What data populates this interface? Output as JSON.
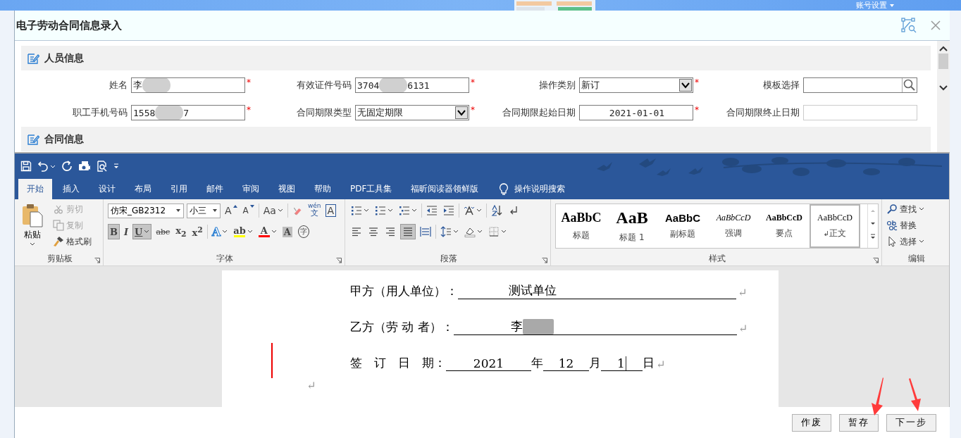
{
  "header": {
    "account_menu": "账号设置"
  },
  "dialog": {
    "title": "电子劳动合同信息录入"
  },
  "sections": [
    {
      "title": "人员信息",
      "fields": [
        {
          "label": "姓名",
          "kind": "text",
          "value_parts": [
            {
              "kind": "text",
              "text": "李"
            },
            {
              "kind": "blur"
            }
          ],
          "required_mark": "*",
          "disabled": false
        },
        {
          "label": "有效证件号码",
          "kind": "text",
          "value_parts": [
            {
              "kind": "text",
              "text": "3704"
            },
            {
              "kind": "blur"
            },
            {
              "kind": "text",
              "text": "6131"
            }
          ],
          "required_mark": "*",
          "disabled": false
        },
        {
          "label": "操作类别",
          "kind": "select",
          "value": "新订",
          "required_mark": "*",
          "disabled": false
        },
        {
          "label": "模板选择",
          "kind": "search",
          "disabled": false
        },
        {
          "label": "职工手机号码",
          "kind": "text",
          "value_parts": [
            {
              "kind": "text",
              "text": "1558"
            },
            {
              "kind": "blur"
            },
            {
              "kind": "text",
              "text": "7"
            }
          ],
          "required_mark": "*",
          "disabled": false
        },
        {
          "label": "合同期限类型",
          "kind": "select",
          "value": "无固定期限",
          "required_mark": "*",
          "disabled": false
        },
        {
          "label": "合同期限起始日期",
          "kind": "date",
          "value": "2021-01-01",
          "required_mark": "*",
          "disabled": false
        },
        {
          "label": "合同期限终止日期",
          "kind": "date",
          "disabled": true
        }
      ]
    },
    {
      "title": "合同信息"
    }
  ],
  "editor": {
    "tabs": [
      {
        "label": "开始",
        "selected": true
      },
      {
        "label": "插入",
        "selected": false
      },
      {
        "label": "设计",
        "selected": false
      },
      {
        "label": "布局",
        "selected": false
      },
      {
        "label": "引用",
        "selected": false
      },
      {
        "label": "邮件",
        "selected": false
      },
      {
        "label": "审阅",
        "selected": false
      },
      {
        "label": "视图",
        "selected": false
      },
      {
        "label": "帮助",
        "selected": false
      },
      {
        "label": "PDF工具集",
        "selected": false
      },
      {
        "label": "福昕阅读器领鲜版",
        "selected": false
      }
    ],
    "tell_me": "操作说明搜索",
    "clipboard": {
      "group": "剪贴板",
      "paste": "粘贴",
      "items": [
        {
          "label": "剪切",
          "kind": "cut",
          "disabled": true
        },
        {
          "label": "复制",
          "kind": "copy",
          "disabled": true
        },
        {
          "label": "格式刷",
          "kind": "painter",
          "disabled": false
        }
      ]
    },
    "font": {
      "group": "字体",
      "name": "仿宋_GB2312",
      "size": "小三",
      "row1": [
        {
          "kind": "grow",
          "glyph": "A"
        },
        {
          "kind": "shrink",
          "glyph": "A"
        },
        {
          "kind": "case",
          "glyph": "Aa"
        },
        {
          "kind": "clear"
        },
        {
          "kind": "phonetic",
          "glyph": "wén",
          "glyph2": "文"
        },
        {
          "kind": "border",
          "glyph": "A"
        }
      ],
      "row2": [
        {
          "kind": "bold",
          "glyph": "B",
          "selected": true
        },
        {
          "kind": "italic",
          "glyph": "I",
          "selected": false
        },
        {
          "kind": "underline",
          "glyph": "U",
          "selected": true
        },
        {
          "kind": "strike",
          "glyph": "abc",
          "selected": false
        },
        {
          "kind": "sub",
          "glyph": "x$_{2}$",
          "selected": false
        },
        {
          "kind": "sup",
          "glyph": "x$^{2}$",
          "selected": false
        },
        {
          "kind": "effects",
          "glyph": "A",
          "selected": false
        },
        {
          "kind": "highlight",
          "glyph": "ab",
          "color": "#ffff00",
          "selected": false
        },
        {
          "kind": "color",
          "glyph": "A",
          "color": "#ff0000",
          "selected": false
        },
        {
          "kind": "shading",
          "glyph": "A",
          "selected": false
        },
        {
          "kind": "enclose",
          "glyph": "字",
          "selected": false
        }
      ]
    },
    "paragraph": {
      "group": "段落",
      "row1": [
        {
          "kind": "bullets",
          "selected": false
        },
        {
          "kind": "numbering",
          "selected": false
        },
        {
          "kind": "multilevel",
          "selected": false
        },
        {
          "kind": "outdent",
          "selected": false
        },
        {
          "kind": "indent",
          "selected": false
        },
        {
          "kind": "asian",
          "selected": false
        },
        {
          "kind": "sort",
          "selected": false
        },
        {
          "kind": "marks",
          "selected": false
        }
      ],
      "row2": [
        {
          "kind": "left",
          "selected": false
        },
        {
          "kind": "center",
          "selected": false
        },
        {
          "kind": "right",
          "selected": false
        },
        {
          "kind": "justify",
          "selected": true
        },
        {
          "kind": "distributed",
          "selected": false
        },
        {
          "kind": "spacing",
          "selected": false
        },
        {
          "kind": "shade",
          "selected": false
        },
        {
          "kind": "borders",
          "selected": false
        }
      ]
    },
    "styles": {
      "group": "样式",
      "items": [
        {
          "kind": "heading",
          "preview": "AaBbC",
          "name": "标题",
          "selected": false
        },
        {
          "kind": "heading1",
          "preview": "AaB",
          "name": "标题 1",
          "selected": false
        },
        {
          "kind": "subtitle",
          "preview": "AaBbC",
          "name": "副标题",
          "selected": false
        },
        {
          "kind": "emphasis",
          "preview": "AaBbCcD",
          "name": "强调",
          "selected": false
        },
        {
          "kind": "strong",
          "preview": "AaBbCcD",
          "name": "要点",
          "selected": false
        },
        {
          "kind": "normal",
          "preview": "AaBbCcD",
          "name": "正文",
          "mark": "↲",
          "selected": true
        }
      ]
    },
    "editing": {
      "group": "编辑",
      "items": [
        {
          "label": "查找",
          "kind": "find"
        },
        {
          "label": "替换",
          "kind": "replace"
        },
        {
          "label": "选择",
          "kind": "select"
        }
      ]
    }
  },
  "document": {
    "lines": [
      {
        "kind": "field",
        "revised": false,
        "mark": "↵",
        "segments": [
          {
            "kind": "label",
            "text": "甲方（用人单位）："
          },
          {
            "kind": "blank",
            "parts": [
              {
                "kind": "text",
                "text": "测试单位"
              }
            ]
          }
        ]
      },
      {
        "kind": "field",
        "revised": false,
        "mark": "↵",
        "segments": [
          {
            "kind": "label",
            "text": "乙方（劳 动 者）："
          },
          {
            "kind": "blank",
            "parts": [
              {
                "kind": "text",
                "text": "李"
              },
              {
                "kind": "blur"
              }
            ]
          }
        ]
      },
      {
        "kind": "field",
        "revised": true,
        "mark": "↵",
        "segments": [
          {
            "kind": "label",
            "text": "签　订　日　期："
          },
          {
            "kind": "blank",
            "parts": [
              {
                "kind": "text",
                "text": "2021"
              }
            ]
          },
          {
            "kind": "label",
            "text": "年"
          },
          {
            "kind": "blank",
            "parts": [
              {
                "kind": "text",
                "text": "12"
              }
            ]
          },
          {
            "kind": "label",
            "text": "月"
          },
          {
            "kind": "blank",
            "parts": [
              {
                "kind": "text",
                "text": "1"
              },
              {
                "kind": "cursor"
              }
            ]
          },
          {
            "kind": "label",
            "text": "日"
          }
        ]
      },
      {
        "kind": "empty",
        "revised": false,
        "mark": "↵"
      }
    ]
  },
  "buttons": [
    {
      "label": "作废"
    },
    {
      "label": "暂存"
    },
    {
      "label": "下一步"
    }
  ]
}
